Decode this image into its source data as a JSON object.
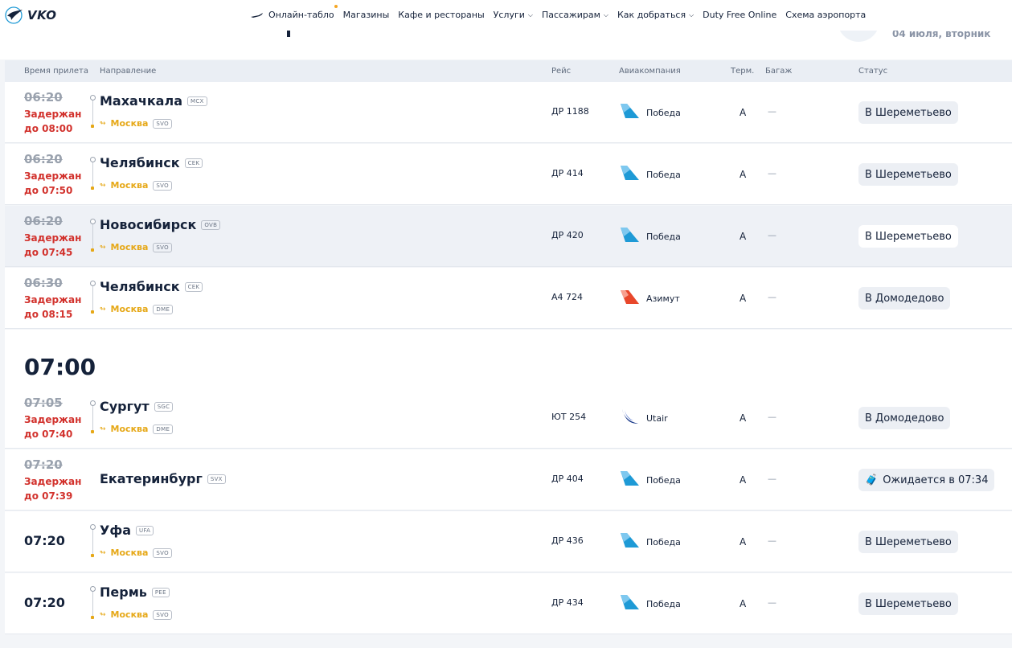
{
  "header": {
    "logo_text": "VKO",
    "nav": [
      {
        "label": "Онлайн-табло",
        "dropdown": false,
        "active": true
      },
      {
        "label": "Магазины",
        "dropdown": false
      },
      {
        "label": "Кафе и рестораны",
        "dropdown": false
      },
      {
        "label": "Услуги",
        "dropdown": true
      },
      {
        "label": "Пассажирам",
        "dropdown": true
      },
      {
        "label": "Как добраться",
        "dropdown": true
      },
      {
        "label": "Duty Free Online",
        "dropdown": false
      },
      {
        "label": "Схема аэропорта",
        "dropdown": false
      }
    ]
  },
  "date": "04 июля, вторник",
  "table": {
    "columns": {
      "time": "Время прилета",
      "direction": "Направление",
      "flight": "Рейс",
      "airline": "Авиакомпания",
      "terminal": "Терм.",
      "baggage": "Багаж",
      "status": "Статус"
    }
  },
  "rows_a": [
    {
      "time_old": "06:20",
      "delay1": "Задержан",
      "delay2": "до 08:00",
      "dest": "Махачкала",
      "dest_code": "MCX",
      "via": "Москва",
      "via_code": "SVO",
      "flight": "ДР 1188",
      "airline": "Победа",
      "airline_logo": "pobeda",
      "terminal": "A",
      "baggage": "—",
      "status": "В Шереметьево"
    },
    {
      "time_old": "06:20",
      "delay1": "Задержан",
      "delay2": "до 07:50",
      "dest": "Челябинск",
      "dest_code": "CEK",
      "via": "Москва",
      "via_code": "SVO",
      "flight": "ДР 414",
      "airline": "Победа",
      "airline_logo": "pobeda",
      "terminal": "A",
      "baggage": "—",
      "status": "В Шереметьево"
    },
    {
      "time_old": "06:20",
      "delay1": "Задержан",
      "delay2": "до 07:45",
      "dest": "Новосибирск",
      "dest_code": "OVB",
      "via": "Москва",
      "via_code": "SVO",
      "flight": "ДР 420",
      "airline": "Победа",
      "airline_logo": "pobeda",
      "terminal": "A",
      "baggage": "—",
      "status": "В Шереметьево"
    },
    {
      "time_old": "06:30",
      "delay1": "Задержан",
      "delay2": "до 08:15",
      "dest": "Челябинск",
      "dest_code": "CEK",
      "via": "Москва",
      "via_code": "DME",
      "flight": "А4 724",
      "airline": "Азимут",
      "airline_logo": "azimut",
      "terminal": "A",
      "baggage": "—",
      "status": "В Домодедово"
    }
  ],
  "hour_label": "07:00",
  "rows_b": [
    {
      "time_old": "07:05",
      "delay1": "Задержан",
      "delay2": "до 07:40",
      "dest": "Сургут",
      "dest_code": "SGC",
      "via": "Москва",
      "via_code": "DME",
      "flight": "ЮТ 254",
      "airline": "Utair",
      "airline_logo": "utair",
      "terminal": "A",
      "baggage": "—",
      "status": "В Домодедово"
    },
    {
      "time_old": "07:20",
      "delay1": "Задержан",
      "delay2": "до 07:39",
      "dest": "Екатеринбург",
      "dest_code": "SVX",
      "flight": "ДР 404",
      "airline": "Победа",
      "airline_logo": "pobeda",
      "terminal": "A",
      "baggage": "—",
      "status": "Ожидается в 07:34",
      "status_icon": "passenger-luggage-icon"
    },
    {
      "time": "07:20",
      "dest": "Уфа",
      "dest_code": "UFA",
      "via": "Москва",
      "via_code": "SVO",
      "flight": "ДР 436",
      "airline": "Победа",
      "airline_logo": "pobeda",
      "terminal": "A",
      "baggage": "—",
      "status": "В Шереметьево"
    },
    {
      "time": "07:20",
      "dest": "Пермь",
      "dest_code": "PEE",
      "via": "Москва",
      "via_code": "SVO",
      "flight": "ДР 434",
      "airline": "Победа",
      "airline_logo": "pobeda",
      "terminal": "A",
      "baggage": "—",
      "status": "В Шереметьево"
    }
  ],
  "colors": {
    "delay": "#d2322d",
    "via": "#e6a817",
    "pobeda": "#1e9ad6",
    "azimut": "#e8472b",
    "utair": "#1b3a8a"
  }
}
